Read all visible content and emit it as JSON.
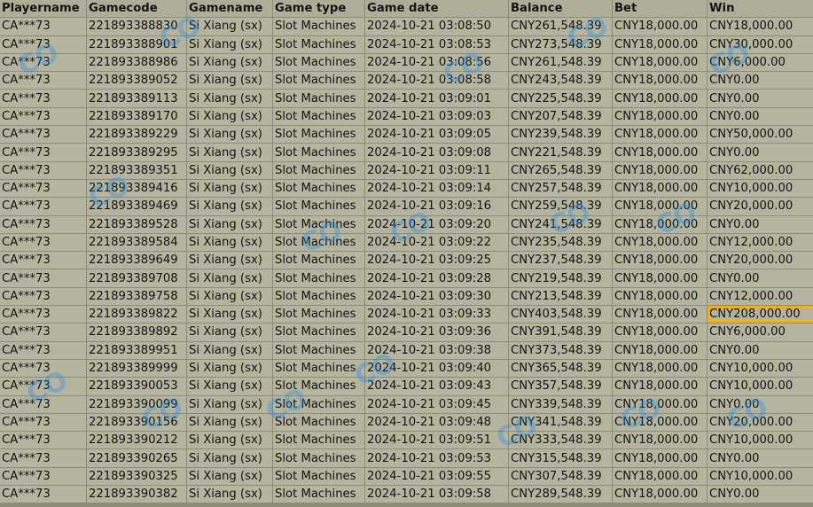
{
  "headers": [
    "Playername",
    "Gamecode",
    "Gamename",
    "Game type",
    "Game date",
    "Balance",
    "Bet",
    "Win"
  ],
  "rows": [
    [
      "CA***73",
      "221893388830",
      "Si Xiang (sx)",
      "Slot Machines",
      "2024-10-21 03:08:50",
      "CNY261,548.39",
      "CNY18,000.00",
      "CNY18,000.00"
    ],
    [
      "CA***73",
      "221893388901",
      "Si Xiang (sx)",
      "Slot Machines",
      "2024-10-21 03:08:53",
      "CNY273,548.39",
      "CNY18,000.00",
      "CNY30,000.00"
    ],
    [
      "CA***73",
      "221893388986",
      "Si Xiang (sx)",
      "Slot Machines",
      "2024-10-21 03:08:56",
      "CNY261,548.39",
      "CNY18,000.00",
      "CNY6,000.00"
    ],
    [
      "CA***73",
      "221893389052",
      "Si Xiang (sx)",
      "Slot Machines",
      "2024-10-21 03:08:58",
      "CNY243,548.39",
      "CNY18,000.00",
      "CNY0.00"
    ],
    [
      "CA***73",
      "221893389113",
      "Si Xiang (sx)",
      "Slot Machines",
      "2024-10-21 03:09:01",
      "CNY225,548.39",
      "CNY18,000.00",
      "CNY0.00"
    ],
    [
      "CA***73",
      "221893389170",
      "Si Xiang (sx)",
      "Slot Machines",
      "2024-10-21 03:09:03",
      "CNY207,548.39",
      "CNY18,000.00",
      "CNY0.00"
    ],
    [
      "CA***73",
      "221893389229",
      "Si Xiang (sx)",
      "Slot Machines",
      "2024-10-21 03:09:05",
      "CNY239,548.39",
      "CNY18,000.00",
      "CNY50,000.00"
    ],
    [
      "CA***73",
      "221893389295",
      "Si Xiang (sx)",
      "Slot Machines",
      "2024-10-21 03:09:08",
      "CNY221,548.39",
      "CNY18,000.00",
      "CNY0.00"
    ],
    [
      "CA***73",
      "221893389351",
      "Si Xiang (sx)",
      "Slot Machines",
      "2024-10-21 03:09:11",
      "CNY265,548.39",
      "CNY18,000.00",
      "CNY62,000.00"
    ],
    [
      "CA***73",
      "221893389416",
      "Si Xiang (sx)",
      "Slot Machines",
      "2024-10-21 03:09:14",
      "CNY257,548.39",
      "CNY18,000.00",
      "CNY10,000.00"
    ],
    [
      "CA***73",
      "221893389469",
      "Si Xiang (sx)",
      "Slot Machines",
      "2024-10-21 03:09:16",
      "CNY259,548.39",
      "CNY18,000.00",
      "CNY20,000.00"
    ],
    [
      "CA***73",
      "221893389528",
      "Si Xiang (sx)",
      "Slot Machines",
      "2024-10-21 03:09:20",
      "CNY241,548.39",
      "CNY18,000.00",
      "CNY0.00"
    ],
    [
      "CA***73",
      "221893389584",
      "Si Xiang (sx)",
      "Slot Machines",
      "2024-10-21 03:09:22",
      "CNY235,548.39",
      "CNY18,000.00",
      "CNY12,000.00"
    ],
    [
      "CA***73",
      "221893389649",
      "Si Xiang (sx)",
      "Slot Machines",
      "2024-10-21 03:09:25",
      "CNY237,548.39",
      "CNY18,000.00",
      "CNY20,000.00"
    ],
    [
      "CA***73",
      "221893389708",
      "Si Xiang (sx)",
      "Slot Machines",
      "2024-10-21 03:09:28",
      "CNY219,548.39",
      "CNY18,000.00",
      "CNY0.00"
    ],
    [
      "CA***73",
      "221893389758",
      "Si Xiang (sx)",
      "Slot Machines",
      "2024-10-21 03:09:30",
      "CNY213,548.39",
      "CNY18,000.00",
      "CNY12,000.00"
    ],
    [
      "CA***73",
      "221893389822",
      "Si Xiang (sx)",
      "Slot Machines",
      "2024-10-21 03:09:33",
      "CNY403,548.39",
      "CNY18,000.00",
      "CNY208,000.00"
    ],
    [
      "CA***73",
      "221893389892",
      "Si Xiang (sx)",
      "Slot Machines",
      "2024-10-21 03:09:36",
      "CNY391,548.39",
      "CNY18,000.00",
      "CNY6,000.00"
    ],
    [
      "CA***73",
      "221893389951",
      "Si Xiang (sx)",
      "Slot Machines",
      "2024-10-21 03:09:38",
      "CNY373,548.39",
      "CNY18,000.00",
      "CNY0.00"
    ],
    [
      "CA***73",
      "221893389999",
      "Si Xiang (sx)",
      "Slot Machines",
      "2024-10-21 03:09:40",
      "CNY365,548.39",
      "CNY18,000.00",
      "CNY10,000.00"
    ],
    [
      "CA***73",
      "221893390053",
      "Si Xiang (sx)",
      "Slot Machines",
      "2024-10-21 03:09:43",
      "CNY357,548.39",
      "CNY18,000.00",
      "CNY10,000.00"
    ],
    [
      "CA***73",
      "221893390099",
      "Si Xiang (sx)",
      "Slot Machines",
      "2024-10-21 03:09:45",
      "CNY339,548.39",
      "CNY18,000.00",
      "CNY0.00"
    ],
    [
      "CA***73",
      "221893390156",
      "Si Xiang (sx)",
      "Slot Machines",
      "2024-10-21 03:09:48",
      "CNY341,548.39",
      "CNY18,000.00",
      "CNY20,000.00"
    ],
    [
      "CA***73",
      "221893390212",
      "Si Xiang (sx)",
      "Slot Machines",
      "2024-10-21 03:09:51",
      "CNY333,548.39",
      "CNY18,000.00",
      "CNY10,000.00"
    ],
    [
      "CA***73",
      "221893390265",
      "Si Xiang (sx)",
      "Slot Machines",
      "2024-10-21 03:09:53",
      "CNY315,548.39",
      "CNY18,000.00",
      "CNY0.00"
    ],
    [
      "CA***73",
      "221893390325",
      "Si Xiang (sx)",
      "Slot Machines",
      "2024-10-21 03:09:55",
      "CNY307,548.39",
      "CNY18,000.00",
      "CNY10,000.00"
    ],
    [
      "CA***73",
      "221893390382",
      "Si Xiang (sx)",
      "Slot Machines",
      "2024-10-21 03:09:58",
      "CNY289,548.39",
      "CNY18,000.00",
      "CNY0.00"
    ]
  ],
  "highlighted_cell": {
    "row": 16,
    "column": 7
  },
  "colors": {
    "cell_background": "#b3b39f",
    "grid_lines": "#8c8c78",
    "highlight_border": "#f0b400",
    "watermark": "#288ce6"
  },
  "watermark": {
    "text": "CO"
  }
}
